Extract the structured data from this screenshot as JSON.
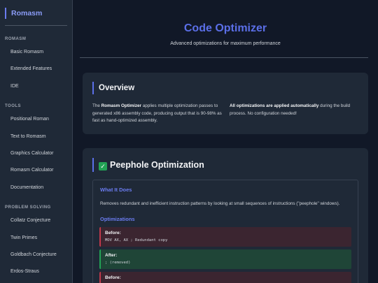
{
  "sidebar": {
    "brand": "Romasm",
    "sections": [
      {
        "heading": "ROMASM",
        "items": [
          "Basic Romasm",
          "Extended Features",
          "IDE"
        ]
      },
      {
        "heading": "TOOLS",
        "items": [
          "Positional Roman",
          "Text to Romasm",
          "Graphics Calculator",
          "Romasm Calculator",
          "Documentation"
        ]
      },
      {
        "heading": "PROBLEM SOLVING",
        "items": [
          "Collatz Conjecture",
          "Twin Primes",
          "Goldbach Conjecture",
          "Erdos-Straus"
        ]
      }
    ]
  },
  "header": {
    "title": "Code Optimizer",
    "subtitle": "Advanced optimizations for maximum performance"
  },
  "overview": {
    "title": "Overview",
    "left_bold": "Romasm Optimizer",
    "left_pre": "The ",
    "left_post": " applies multiple optimization passes to generated x86 assembly code, producing output that is 90-98% as fast as hand-optimized assembly.",
    "right_bold": "All optimizations are applied automatically",
    "right_post": " during the build process. No configuration needed!"
  },
  "peephole": {
    "icon": "check-mark-icon",
    "icon_glyph": "✓",
    "title": "Peephole Optimization",
    "what_heading": "What It Does",
    "what_text": "Removes redundant and inefficient instruction patterns by looking at small sequences of instructions (\"peephole\" windows).",
    "opt_heading": "Optimizations",
    "examples": [
      {
        "label": "Before:",
        "code": "MOV AX, AX ; Redundant copy",
        "kind": "before"
      },
      {
        "label": "After:",
        "code": "; (removed)",
        "kind": "after"
      },
      {
        "label": "Before:",
        "code": "",
        "kind": "before"
      }
    ]
  },
  "colors": {
    "accent": "#5b6fe8",
    "before": "#c0394b",
    "after": "#22a355"
  }
}
